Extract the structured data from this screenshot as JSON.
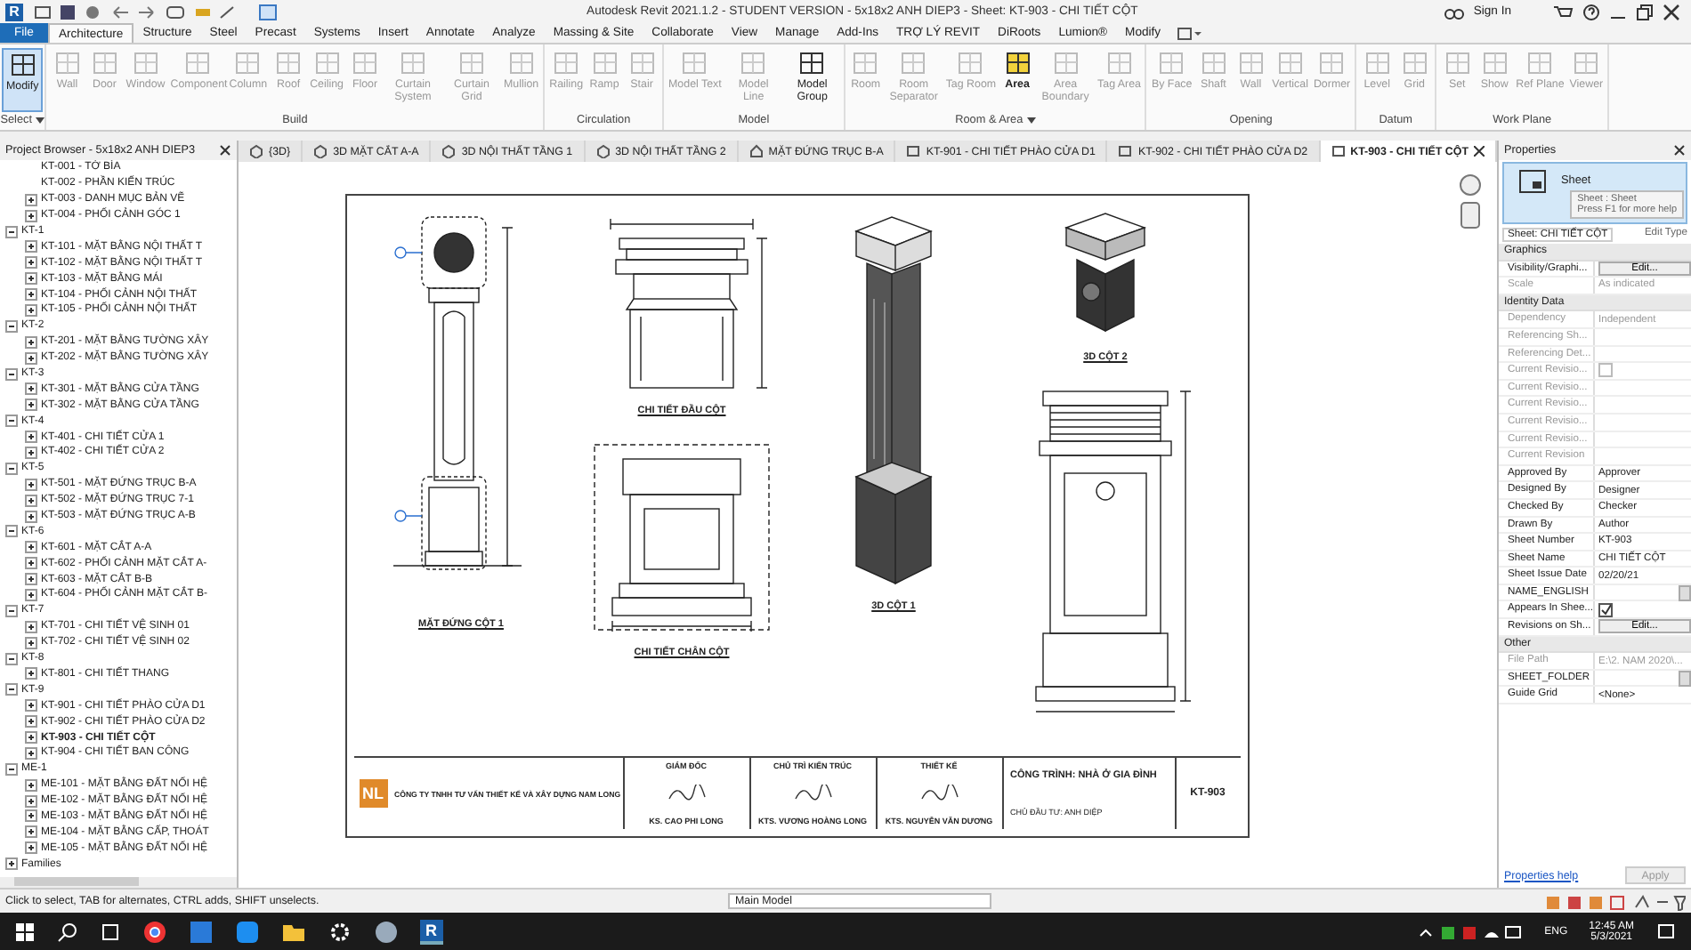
{
  "window": {
    "logo": "R",
    "title": "Autodesk Revit 2021.1.2 - STUDENT VERSION - 5x18x2 ANH DIEP3 - Sheet: KT-903 - CHI TIẾT CỘT",
    "sign_in": "Sign In"
  },
  "ribbon": {
    "tabs": [
      {
        "label": "File",
        "kind": "file",
        "selected": false
      },
      {
        "label": "Architecture",
        "kind": "tab",
        "selected": true
      },
      {
        "label": "Structure",
        "kind": "tab",
        "selected": false
      },
      {
        "label": "Steel",
        "kind": "tab",
        "selected": false
      },
      {
        "label": "Precast",
        "kind": "tab",
        "selected": false
      },
      {
        "label": "Systems",
        "kind": "tab",
        "selected": false
      },
      {
        "label": "Insert",
        "kind": "tab",
        "selected": false
      },
      {
        "label": "Annotate",
        "kind": "tab",
        "selected": false
      },
      {
        "label": "Analyze",
        "kind": "tab",
        "selected": false
      },
      {
        "label": "Massing & Site",
        "kind": "tab",
        "selected": false
      },
      {
        "label": "Collaborate",
        "kind": "tab",
        "selected": false
      },
      {
        "label": "View",
        "kind": "tab",
        "selected": false
      },
      {
        "label": "Manage",
        "kind": "tab",
        "selected": false
      },
      {
        "label": "Add-Ins",
        "kind": "tab",
        "selected": false
      },
      {
        "label": "TRỢ LÝ REVIT",
        "kind": "tab",
        "selected": false
      },
      {
        "label": "DiRoots",
        "kind": "tab",
        "selected": false
      },
      {
        "label": "Lumion®",
        "kind": "tab",
        "selected": false
      },
      {
        "label": "Modify",
        "kind": "tab",
        "selected": false
      }
    ],
    "panels": [
      {
        "label": "Select",
        "dropdown": true,
        "tools": [
          {
            "label": "Modify",
            "disabled": false,
            "selected": true,
            "hovered": false
          }
        ]
      },
      {
        "label": "Build",
        "dropdown": false,
        "tools": [
          {
            "label": "Wall",
            "disabled": true,
            "selected": false,
            "hovered": false
          },
          {
            "label": "Door",
            "disabled": true,
            "selected": false,
            "hovered": false
          },
          {
            "label": "Window",
            "disabled": true,
            "selected": false,
            "hovered": false
          },
          {
            "label": "Component",
            "disabled": true,
            "selected": false,
            "hovered": false
          },
          {
            "label": "Column",
            "disabled": true,
            "selected": false,
            "hovered": false
          },
          {
            "label": "Roof",
            "disabled": true,
            "selected": false,
            "hovered": false
          },
          {
            "label": "Ceiling",
            "disabled": true,
            "selected": false,
            "hovered": false
          },
          {
            "label": "Floor",
            "disabled": true,
            "selected": false,
            "hovered": false
          },
          {
            "label": "Curtain System",
            "disabled": true,
            "selected": false,
            "hovered": false
          },
          {
            "label": "Curtain Grid",
            "disabled": true,
            "selected": false,
            "hovered": false
          },
          {
            "label": "Mullion",
            "disabled": true,
            "selected": false,
            "hovered": false
          }
        ]
      },
      {
        "label": "Circulation",
        "dropdown": false,
        "tools": [
          {
            "label": "Railing",
            "disabled": true,
            "selected": false,
            "hovered": false
          },
          {
            "label": "Ramp",
            "disabled": true,
            "selected": false,
            "hovered": false
          },
          {
            "label": "Stair",
            "disabled": true,
            "selected": false,
            "hovered": false
          }
        ]
      },
      {
        "label": "Model",
        "dropdown": false,
        "tools": [
          {
            "label": "Model Text",
            "disabled": true,
            "selected": false,
            "hovered": false
          },
          {
            "label": "Model Line",
            "disabled": true,
            "selected": false,
            "hovered": false
          },
          {
            "label": "Model Group",
            "disabled": false,
            "selected": false,
            "hovered": false
          }
        ]
      },
      {
        "label": "Room & Area",
        "dropdown": true,
        "tools": [
          {
            "label": "Room",
            "disabled": true,
            "selected": false,
            "hovered": false
          },
          {
            "label": "Room Separator",
            "disabled": true,
            "selected": false,
            "hovered": false
          },
          {
            "label": "Tag Room",
            "disabled": true,
            "selected": false,
            "hovered": false
          },
          {
            "label": "Area",
            "disabled": false,
            "selected": false,
            "hovered": true
          },
          {
            "label": "Area Boundary",
            "disabled": true,
            "selected": false,
            "hovered": false
          },
          {
            "label": "Tag Area",
            "disabled": true,
            "selected": false,
            "hovered": false
          }
        ]
      },
      {
        "label": "Opening",
        "dropdown": false,
        "tools": [
          {
            "label": "By Face",
            "disabled": true,
            "selected": false,
            "hovered": false
          },
          {
            "label": "Shaft",
            "disabled": true,
            "selected": false,
            "hovered": false
          },
          {
            "label": "Wall",
            "disabled": true,
            "selected": false,
            "hovered": false
          },
          {
            "label": "Vertical",
            "disabled": true,
            "selected": false,
            "hovered": false
          },
          {
            "label": "Dormer",
            "disabled": true,
            "selected": false,
            "hovered": false
          }
        ]
      },
      {
        "label": "Datum",
        "dropdown": false,
        "tools": [
          {
            "label": "Level",
            "disabled": true,
            "selected": false,
            "hovered": false
          },
          {
            "label": "Grid",
            "disabled": true,
            "selected": false,
            "hovered": false
          }
        ]
      },
      {
        "label": "Work Plane",
        "dropdown": false,
        "tools": [
          {
            "label": "Set",
            "disabled": true,
            "selected": false,
            "hovered": false
          },
          {
            "label": "Show",
            "disabled": true,
            "selected": false,
            "hovered": false
          },
          {
            "label": "Ref Plane",
            "disabled": true,
            "selected": false,
            "hovered": false
          },
          {
            "label": "Viewer",
            "disabled": true,
            "selected": false,
            "hovered": false
          }
        ]
      }
    ]
  },
  "browser": {
    "title": "Project Browser - 5x18x2 ANH DIEP3",
    "items": [
      {
        "label": "KT-001 - TỜ BÌA",
        "expandable": false,
        "selected": false
      },
      {
        "label": "KT-002 - PHẦN KIẾN TRÚC",
        "expandable": false,
        "selected": false
      },
      {
        "label": "KT-003 - DANH MỤC BẢN VẼ",
        "expandable": true,
        "selected": false
      },
      {
        "label": "KT-004 - PHỐI CẢNH GÓC 1",
        "expandable": true,
        "selected": false
      },
      {
        "label": "KT-1",
        "expanded": true,
        "children": [
          {
            "label": "KT-101 - MẶT BẰNG NỘI THẤT T",
            "expandable": true,
            "selected": false
          },
          {
            "label": "KT-102 - MẶT BẰNG NỘI THẤT T",
            "expandable": true,
            "selected": false
          },
          {
            "label": "KT-103 - MẶT BẰNG MÁI",
            "expandable": true,
            "selected": false
          },
          {
            "label": "KT-104 - PHỐI CẢNH NỘI THẤT",
            "expandable": true,
            "selected": false
          },
          {
            "label": "KT-105 - PHỐI CẢNH NỘI THẤT",
            "expandable": true,
            "selected": false
          }
        ]
      },
      {
        "label": "KT-2",
        "expanded": true,
        "children": [
          {
            "label": "KT-201 - MẶT BẰNG TƯỜNG XÂY",
            "expandable": true,
            "selected": false
          },
          {
            "label": "KT-202 - MẶT BẰNG TƯỜNG XÂY",
            "expandable": true,
            "selected": false
          }
        ]
      },
      {
        "label": "KT-3",
        "expanded": true,
        "children": [
          {
            "label": "KT-301 - MẶT BẰNG CỬA TẦNG",
            "expandable": true,
            "selected": false
          },
          {
            "label": "KT-302 - MẶT BẰNG CỬA TẦNG",
            "expandable": true,
            "selected": false
          }
        ]
      },
      {
        "label": "KT-4",
        "expanded": true,
        "children": [
          {
            "label": "KT-401 - CHI TIẾT CỬA 1",
            "expandable": true,
            "selected": false
          },
          {
            "label": "KT-402 - CHI TIẾT CỬA 2",
            "expandable": true,
            "selected": false
          }
        ]
      },
      {
        "label": "KT-5",
        "expanded": true,
        "children": [
          {
            "label": "KT-501 - MẶT ĐỨNG TRỤC B-A",
            "expandable": true,
            "selected": false
          },
          {
            "label": "KT-502 - MẶT ĐỨNG TRỤC 7-1",
            "expandable": true,
            "selected": false
          },
          {
            "label": "KT-503 - MẶT ĐỨNG TRỤC A-B",
            "expandable": true,
            "selected": false
          }
        ]
      },
      {
        "label": "KT-6",
        "expanded": true,
        "children": [
          {
            "label": "KT-601 - MẶT CẮT A-A",
            "expandable": true,
            "selected": false
          },
          {
            "label": "KT-602 - PHỐI CẢNH MẶT CẮT A-",
            "expandable": true,
            "selected": false
          },
          {
            "label": "KT-603 - MẶT CẮT B-B",
            "expandable": true,
            "selected": false
          },
          {
            "label": "KT-604 - PHỐI CẢNH MẶT CẮT B-",
            "expandable": true,
            "selected": false
          }
        ]
      },
      {
        "label": "KT-7",
        "expanded": true,
        "children": [
          {
            "label": "KT-701 - CHI TIẾT VỆ SINH 01",
            "expandable": true,
            "selected": false
          },
          {
            "label": "KT-702 - CHI TIẾT VỆ SINH 02",
            "expandable": true,
            "selected": false
          }
        ]
      },
      {
        "label": "KT-8",
        "expanded": true,
        "children": [
          {
            "label": "KT-801 - CHI TIẾT THANG",
            "expandable": true,
            "selected": false
          }
        ]
      },
      {
        "label": "KT-9",
        "expanded": true,
        "children": [
          {
            "label": "KT-901 - CHI TIẾT PHÀO CỬA D1",
            "expandable": true,
            "selected": false
          },
          {
            "label": "KT-902 - CHI TIẾT PHÀO CỬA D2",
            "expandable": true,
            "selected": false
          },
          {
            "label": "KT-903 - CHI TIẾT CỘT",
            "expandable": true,
            "selected": true
          },
          {
            "label": "KT-904 - CHI TIẾT BAN CÔNG",
            "expandable": true,
            "selected": false
          }
        ]
      },
      {
        "label": "ME-1",
        "expanded": true,
        "children": [
          {
            "label": "ME-101 - MẶT BẰNG ĐẤT NỐI HỆ",
            "expandable": true,
            "selected": false
          },
          {
            "label": "ME-102 - MẶT BẰNG ĐẤT NỐI HỆ",
            "expandable": true,
            "selected": false
          },
          {
            "label": "ME-103 - MẶT BẰNG ĐẤT NỐI HỆ",
            "expandable": true,
            "selected": false
          },
          {
            "label": "ME-104 - MẶT BẰNG CẤP, THOÁT",
            "expandable": true,
            "selected": false
          },
          {
            "label": "ME-105 - MẶT BẰNG ĐẤT NỐI HỆ",
            "expandable": true,
            "selected": false
          }
        ]
      },
      {
        "label": "Families",
        "expanded": false
      }
    ]
  },
  "view_tabs": [
    {
      "label": "{3D}",
      "kind": "model",
      "selected": false
    },
    {
      "label": "3D MẶT CẮT A-A",
      "kind": "model",
      "selected": false
    },
    {
      "label": "3D NỘI THẤT TẦNG 1",
      "kind": "model",
      "selected": false
    },
    {
      "label": "3D NỘI THẤT TẦNG 2",
      "kind": "model",
      "selected": false
    },
    {
      "label": "MẶT ĐỨNG TRỤC B-A",
      "kind": "elevation",
      "selected": false
    },
    {
      "label": "KT-901 - CHI TIẾT PHÀO CỬA D1",
      "kind": "sheet",
      "selected": false
    },
    {
      "label": "KT-902 - CHI TIẾT PHÀO CỬA D2",
      "kind": "sheet",
      "selected": false
    },
    {
      "label": "KT-903 - CHI TIẾT CỘT",
      "kind": "sheet",
      "selected": true
    }
  ],
  "sheet": {
    "columns": [
      [
        {
          "kind": "elevation",
          "caption": "MẶT ĐỨNG CỘT 1"
        }
      ],
      [
        {
          "kind": "head",
          "caption": "CHI TIẾT ĐẦU CỘT"
        },
        {
          "kind": "base",
          "caption": "CHI TIẾT CHÂN CỘT"
        }
      ],
      [
        {
          "kind": "column3d",
          "caption": "3D CỘT 1"
        }
      ],
      [
        {
          "kind": "capital3d",
          "caption": "3D CỘT 2"
        },
        {
          "kind": "front"
        }
      ]
    ],
    "title_block": {
      "logo": "NL",
      "company": "CÔNG TY TNHH TƯ VẤN THIẾT KẾ VÀ XÂY DỰNG NAM LONG",
      "signers": [
        {
          "role": "GIÁM ĐỐC",
          "name": "KS. CAO PHI LONG"
        },
        {
          "role": "CHỦ TRÌ KIẾN TRÚC",
          "name": "KTS. VƯƠNG HOÀNG LONG"
        },
        {
          "role": "THIẾT KẾ",
          "name": "KTS. NGUYỄN VĂN DƯƠNG"
        }
      ],
      "project": "CÔNG TRÌNH: NHÀ Ở GIA ĐÌNH",
      "owner": "CHỦ ĐẦU TƯ: ANH DIỆP",
      "number": "KT-903"
    }
  },
  "properties": {
    "title": "Properties",
    "type_name": "Sheet",
    "tooltip": {
      "title": "Sheet : Sheet",
      "hint": "Press F1 for more help"
    },
    "instance": "Sheet: CHI TIẾT CỘT",
    "edit_type": "Edit Type",
    "sections": [
      {
        "label": "Graphics",
        "rows": [
          {
            "label": "Visibility/Graphi...",
            "kind": "button",
            "value": "Edit...",
            "disabled": false
          },
          {
            "label": "Scale",
            "kind": "text",
            "value": "As indicated",
            "disabled": true
          }
        ]
      },
      {
        "label": "Identity Data",
        "rows": [
          {
            "label": "Dependency",
            "kind": "text",
            "value": "Independent",
            "disabled": true
          },
          {
            "label": "Referencing Sh...",
            "kind": "text",
            "disabled": true
          },
          {
            "label": "Referencing Det...",
            "kind": "text",
            "disabled": true
          },
          {
            "label": "Current Revisio...",
            "kind": "checkbox",
            "checked": false,
            "disabled": true
          },
          {
            "label": "Current Revisio...",
            "kind": "text",
            "disabled": true
          },
          {
            "label": "Current Revisio...",
            "kind": "text",
            "disabled": true
          },
          {
            "label": "Current Revisio...",
            "kind": "text",
            "disabled": true
          },
          {
            "label": "Current Revisio...",
            "kind": "text",
            "disabled": true
          },
          {
            "label": "Current Revision",
            "kind": "text",
            "disabled": true
          },
          {
            "label": "Approved By",
            "kind": "text",
            "value": "Approver",
            "disabled": false
          },
          {
            "label": "Designed By",
            "kind": "text",
            "value": "Designer",
            "disabled": false
          },
          {
            "label": "Checked By",
            "kind": "text",
            "value": "Checker",
            "disabled": false
          },
          {
            "label": "Drawn By",
            "kind": "text",
            "value": "Author",
            "disabled": false
          },
          {
            "label": "Sheet Number",
            "kind": "text",
            "value": "KT-903",
            "disabled": false
          },
          {
            "label": "Sheet Name",
            "kind": "text",
            "value": "CHI TIẾT CỘT",
            "disabled": false
          },
          {
            "label": "Sheet Issue Date",
            "kind": "text",
            "value": "02/20/21",
            "disabled": false
          },
          {
            "label": "NAME_ENGLISH",
            "kind": "field",
            "disabled": false
          },
          {
            "label": "Appears In Shee...",
            "kind": "checkbox",
            "checked": true,
            "disabled": false
          },
          {
            "label": "Revisions on Sh...",
            "kind": "button",
            "value": "Edit...",
            "disabled": false
          }
        ]
      },
      {
        "label": "Other",
        "rows": [
          {
            "label": "File Path",
            "kind": "text",
            "value": "E:\\2. NAM 2020\\...",
            "disabled": true
          },
          {
            "label": "SHEET_FOLDER",
            "kind": "field",
            "disabled": false
          },
          {
            "label": "Guide Grid",
            "kind": "text",
            "value": "<None>",
            "disabled": false
          }
        ]
      }
    ],
    "help": "Properties help",
    "apply": "Apply"
  },
  "status_bar": {
    "message": "Click to select, TAB for alternates, CTRL adds, SHIFT unselects.",
    "model": "Main Model"
  },
  "taskbar": {
    "revit": "R",
    "language": "ENG",
    "time": "12:45 AM",
    "date": "5/3/2021"
  }
}
